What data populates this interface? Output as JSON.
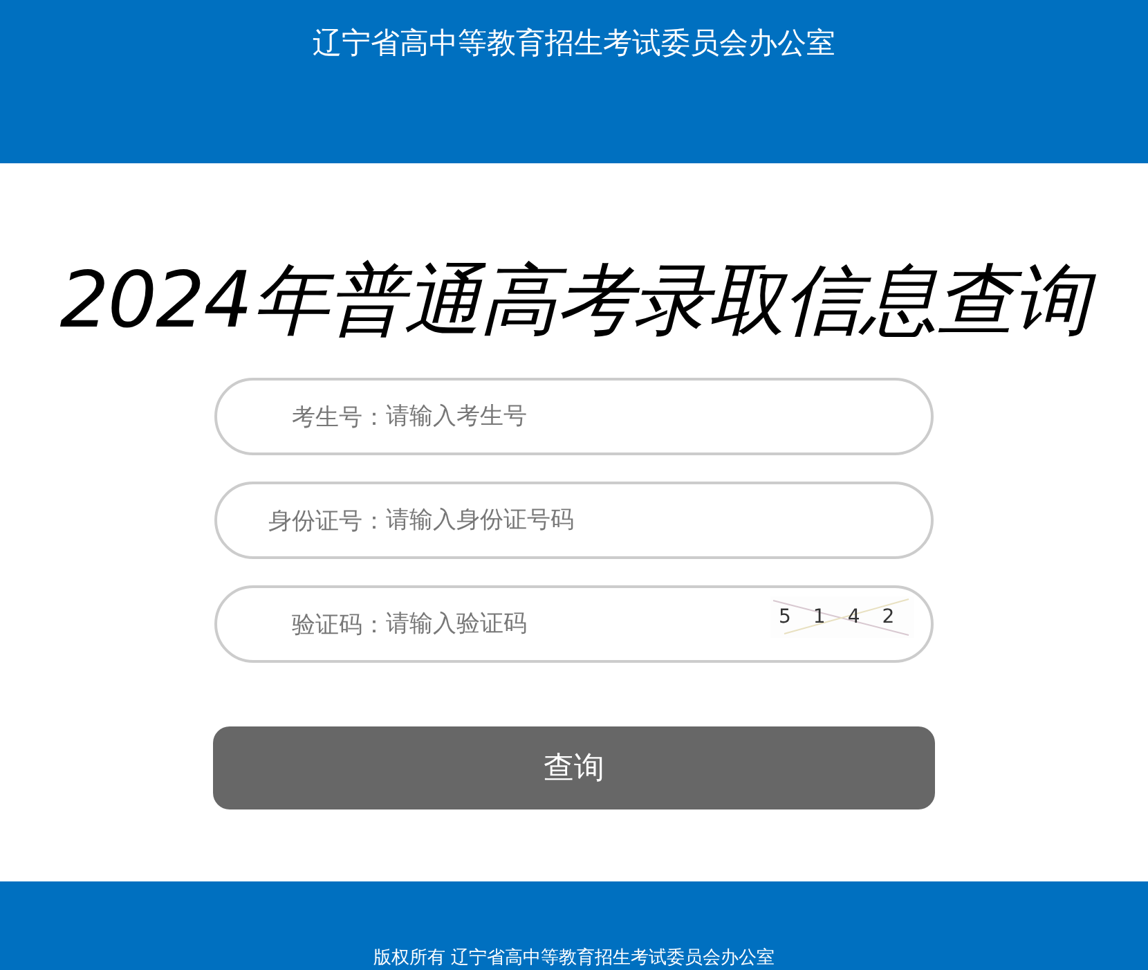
{
  "header": {
    "title": "辽宁省高中等教育招生考试委员会办公室"
  },
  "page_title": "2024年普通高考录取信息查询",
  "fields": [
    {
      "label": "考生号：",
      "placeholder": "请输入考生号"
    },
    {
      "label": "身份证号：",
      "placeholder": "请输入身份证号码"
    },
    {
      "label": "验证码：",
      "placeholder": "请输入验证码",
      "captcha": "5142"
    }
  ],
  "submit_button": "查询",
  "footer": {
    "copyright": "版权所有 辽宁省高中等教育招生考试委员会办公室"
  }
}
